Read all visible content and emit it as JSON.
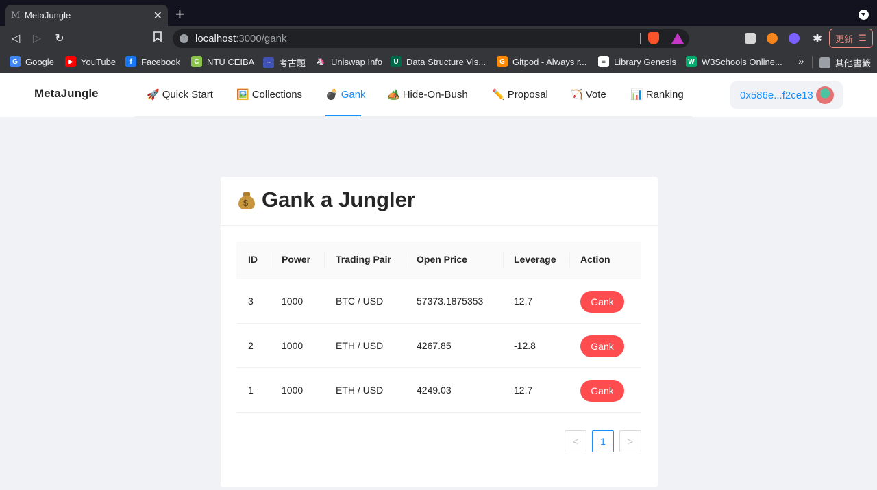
{
  "browser": {
    "tab_title": "MetaJungle",
    "tab_favicon": "M",
    "url_host": "localhost",
    "url_path": ":3000/gank",
    "update_label": "更新",
    "bookmarks": [
      {
        "label": "Google",
        "icon": "G",
        "color": "#4285f4"
      },
      {
        "label": "YouTube",
        "icon": "▶",
        "color": "#ff0000"
      },
      {
        "label": "Facebook",
        "icon": "f",
        "color": "#1877f2"
      },
      {
        "label": "NTU CEIBA",
        "icon": "C",
        "color": "#8bc34a"
      },
      {
        "label": "考古題",
        "icon": "~",
        "color": "#3f51b5"
      },
      {
        "label": "Uniswap Info",
        "icon": "🦄",
        "color": "#35363a"
      },
      {
        "label": "Data Structure Vis...",
        "icon": "U",
        "color": "#006747"
      },
      {
        "label": "Gitpod - Always r...",
        "icon": "G",
        "color": "#ff8a00"
      },
      {
        "label": "Library Genesis",
        "icon": "≡",
        "color": "#ffffff"
      },
      {
        "label": "W3Schools Online...",
        "icon": "W",
        "color": "#04aa6d"
      }
    ],
    "more_bookmarks": "»",
    "other_bookmarks": "其他書籤"
  },
  "app": {
    "logo": "MetaJungle",
    "menu": [
      {
        "emoji": "🚀",
        "label": "Quick Start"
      },
      {
        "emoji": "🖼️",
        "label": "Collections"
      },
      {
        "emoji": "💣",
        "label": "Gank"
      },
      {
        "emoji": "🏕️",
        "label": "Hide-On-Bush"
      },
      {
        "emoji": "✏️",
        "label": "Proposal"
      },
      {
        "emoji": "🏹",
        "label": "Vote"
      },
      {
        "emoji": "📊",
        "label": "Ranking"
      }
    ],
    "active_menu": "Gank",
    "account": "0x586e...f2ce13"
  },
  "main": {
    "title": "Gank a Jungler",
    "columns": [
      "ID",
      "Power",
      "Trading Pair",
      "Open Price",
      "Leverage",
      "Action"
    ],
    "rows": [
      {
        "id": "3",
        "power": "1000",
        "pair": "BTC / USD",
        "open_price": "57373.1875353",
        "leverage": "12.7",
        "action": "Gank"
      },
      {
        "id": "2",
        "power": "1000",
        "pair": "ETH / USD",
        "open_price": "4267.85",
        "leverage": "-12.8",
        "action": "Gank"
      },
      {
        "id": "1",
        "power": "1000",
        "pair": "ETH / USD",
        "open_price": "4249.03",
        "leverage": "12.7",
        "action": "Gank"
      }
    ],
    "pagination": {
      "prev": "<",
      "current": "1",
      "next": ">"
    }
  },
  "colors": {
    "primary": "#1890ff",
    "danger": "#ff4d4f"
  }
}
